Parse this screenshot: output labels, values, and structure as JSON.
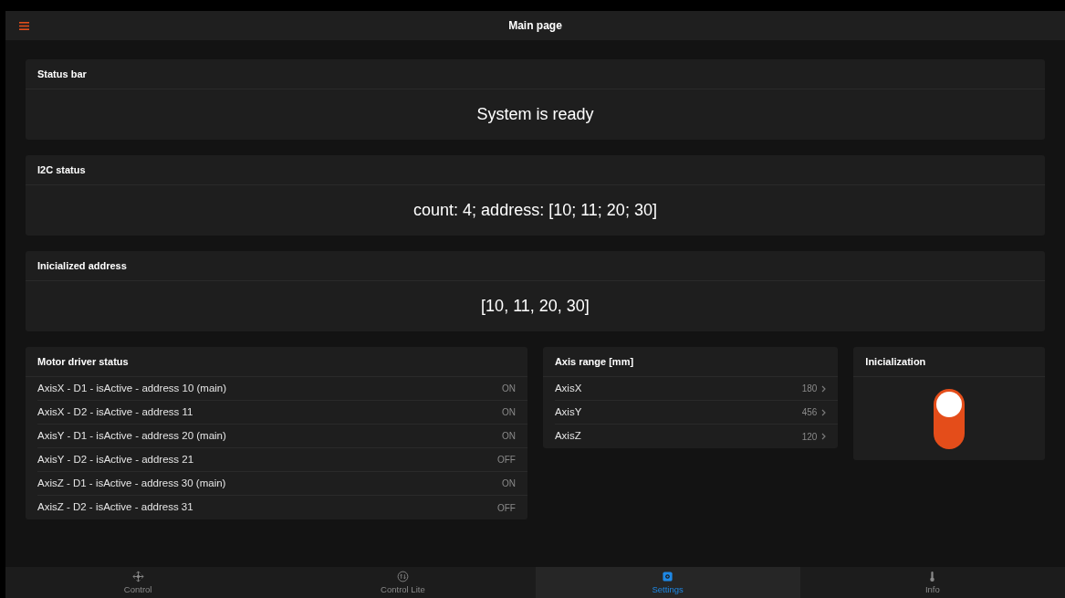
{
  "header": {
    "title": "Main page"
  },
  "info_cards": [
    {
      "title": "Status bar",
      "value": "System is ready"
    },
    {
      "title": "I2C status",
      "value": "count: 4; address: [10; 11; 20; 30]"
    },
    {
      "title": "Inicialized address",
      "value": "[10, 11, 20, 30]"
    }
  ],
  "motor_driver_status": {
    "title": "Motor driver status",
    "rows": [
      {
        "label": "AxisX - D1 - isActive - address 10 (main)",
        "value": "ON"
      },
      {
        "label": "AxisX - D2 - isActive - address 11",
        "value": "ON"
      },
      {
        "label": "AxisY - D1 - isActive - address 20 (main)",
        "value": "ON"
      },
      {
        "label": "AxisY - D2 - isActive - address 21",
        "value": "OFF"
      },
      {
        "label": "AxisZ - D1 - isActive - address 30 (main)",
        "value": "ON"
      },
      {
        "label": "AxisZ - D2 - isActive - address 31",
        "value": "OFF"
      }
    ]
  },
  "axis_range": {
    "title": "Axis range [mm]",
    "rows": [
      {
        "label": "AxisX",
        "value": "180"
      },
      {
        "label": "AxisY",
        "value": "456"
      },
      {
        "label": "AxisZ",
        "value": "120"
      }
    ]
  },
  "initialization": {
    "title": "Inicialization",
    "on": true
  },
  "tabs": [
    {
      "label": "Control",
      "selected": false
    },
    {
      "label": "Control Lite",
      "selected": false
    },
    {
      "label": "Settings",
      "selected": true
    },
    {
      "label": "Info",
      "selected": false
    }
  ]
}
